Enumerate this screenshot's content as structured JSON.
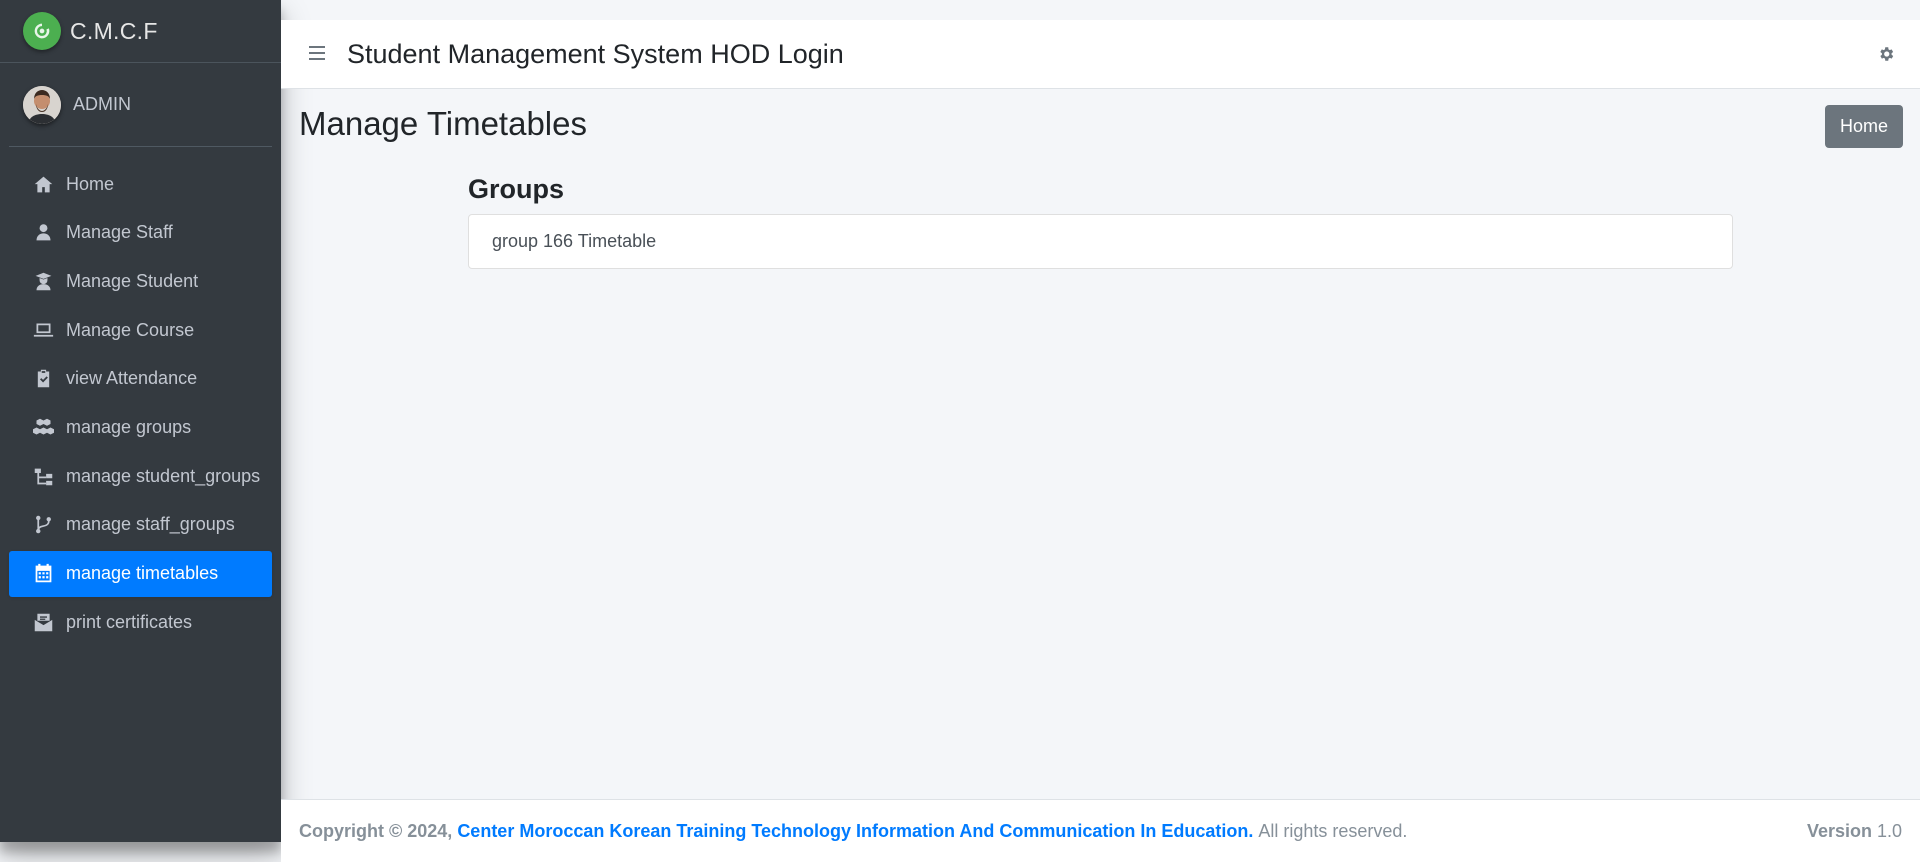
{
  "brand": {
    "name": "C.M.C.F",
    "logo_icon": "brand-logo-icon"
  },
  "user": {
    "name": "ADMIN"
  },
  "sidebar": {
    "items": [
      {
        "label": "Home",
        "icon": "home-icon"
      },
      {
        "label": "Manage Staff",
        "icon": "user-tie-icon"
      },
      {
        "label": "Manage Student",
        "icon": "user-graduate-icon"
      },
      {
        "label": "Manage Course",
        "icon": "laptop-icon"
      },
      {
        "label": "view Attendance",
        "icon": "clipboard-check-icon"
      },
      {
        "label": "manage groups",
        "icon": "cubes-icon"
      },
      {
        "label": "manage student_groups",
        "icon": "sitemap-icon"
      },
      {
        "label": "manage staff_groups",
        "icon": "code-branch-icon"
      },
      {
        "label": "manage timetables",
        "icon": "calendar-icon",
        "active": true
      },
      {
        "label": "print certificates",
        "icon": "certificate-envelope-icon"
      }
    ]
  },
  "header": {
    "title": "Student Management System HOD Login"
  },
  "main": {
    "page_title": "Manage Timetables",
    "home_button": "Home",
    "section_title": "Groups",
    "list_items": [
      "group 166 Timetable"
    ]
  },
  "footer": {
    "copyright": "Copyright © 2024,",
    "org_link": "Center Moroccan Korean Training Technology Information And Communication In Education.",
    "rights": "All rights reserved.",
    "version_label": "Version",
    "version_value": "1.0"
  },
  "colors": {
    "sidebar_bg": "#343a40",
    "accent": "#007bff",
    "button_secondary": "#6c757d",
    "brand_logo": "#4caf50"
  }
}
